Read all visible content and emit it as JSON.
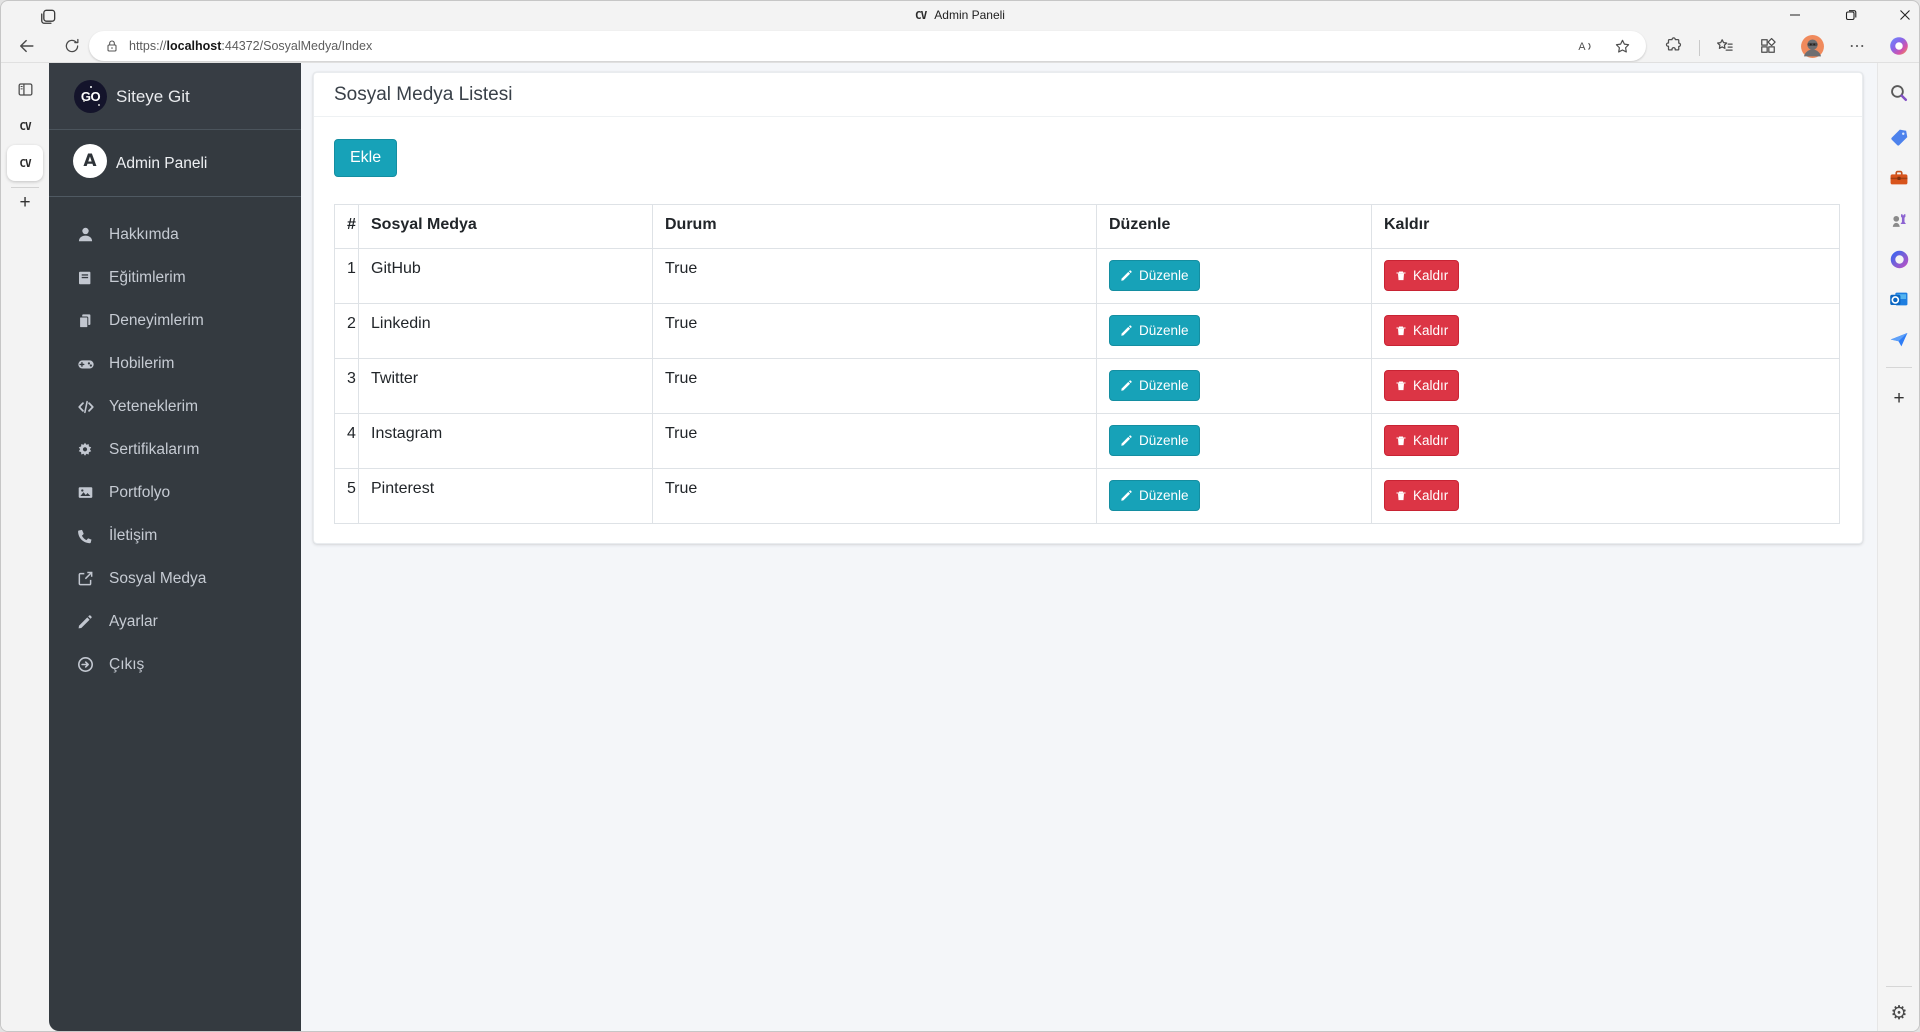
{
  "window": {
    "title": "Admin Paneli",
    "favicon": "CV",
    "controls": {
      "minimize": "minimize-icon",
      "restore": "restore-icon",
      "close": "close-icon"
    }
  },
  "toolbar": {
    "url": {
      "scheme": "https://",
      "host": "localhost",
      "path": ":44372/SosyalMedya/Index"
    },
    "icons": [
      "back-icon",
      "refresh-icon",
      "lock-icon",
      "read-aloud-icon",
      "favorite-star-icon",
      "extensions-icon",
      "collections-icon",
      "apps-grid-icon",
      "profile-avatar",
      "more-icon",
      "copilot-icon"
    ]
  },
  "tabstrip": {
    "pane_icon": "vertical-tabs-icon",
    "tabs": [
      {
        "favicon": "CV",
        "active": false
      },
      {
        "favicon": "CV",
        "active": true
      }
    ],
    "new_tab_label": "+"
  },
  "edge_rail": {
    "items": [
      {
        "icon": "search"
      },
      {
        "icon": "shopping"
      },
      {
        "icon": "toolbox"
      },
      {
        "icon": "games"
      },
      {
        "icon": "m365"
      },
      {
        "icon": "outlook"
      },
      {
        "icon": "paper-plane"
      }
    ],
    "add_label": "+",
    "settings_icon": "⚙"
  },
  "app": {
    "brand": {
      "logo": "GO",
      "label": "Siteye Git"
    },
    "user": {
      "avatar_letter": "A",
      "label": "Admin Paneli"
    },
    "nav": [
      {
        "icon": "user",
        "label": "Hakkımda"
      },
      {
        "icon": "book",
        "label": "Eğitimlerim"
      },
      {
        "icon": "copy",
        "label": "Deneyimlerim"
      },
      {
        "icon": "gamepad",
        "label": "Hobilerim"
      },
      {
        "icon": "code",
        "label": "Yeteneklerim"
      },
      {
        "icon": "certificate",
        "label": "Sertifikalarım"
      },
      {
        "icon": "images",
        "label": "Portfolyo"
      },
      {
        "icon": "phone",
        "label": "İletişim"
      },
      {
        "icon": "share",
        "label": "Sosyal Medya"
      },
      {
        "icon": "pencil",
        "label": "Ayarlar"
      },
      {
        "icon": "signout",
        "label": "Çıkış"
      }
    ],
    "page": {
      "title": "Sosyal Medya Listesi",
      "add_button_label": "Ekle",
      "table": {
        "headers": [
          "#",
          "Sosyal Medya",
          "Durum",
          "Düzenle",
          "Kaldır"
        ],
        "edit_label": "Düzenle",
        "remove_label": "Kaldır",
        "rows": [
          {
            "no": "1",
            "name": "GitHub",
            "status": "True"
          },
          {
            "no": "2",
            "name": "Linkedin",
            "status": "True"
          },
          {
            "no": "3",
            "name": "Twitter",
            "status": "True"
          },
          {
            "no": "4",
            "name": "Instagram",
            "status": "True"
          },
          {
            "no": "5",
            "name": "Pinterest",
            "status": "True"
          }
        ]
      }
    }
  },
  "colors": {
    "accent_teal": "#17a2b8",
    "danger_red": "#dc3545",
    "sidebar_dark": "#343a40",
    "page_bg": "#f4f6f9",
    "chrome_bg": "#f3f3f3"
  }
}
